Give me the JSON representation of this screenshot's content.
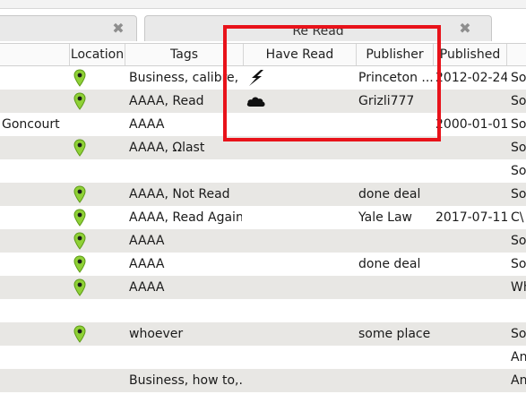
{
  "tabs": [
    {
      "label": "",
      "close_icon": "close-x-icon"
    },
    {
      "label": "Re Read",
      "close_icon": "close-x-icon"
    }
  ],
  "columns": [
    "Location",
    "Tags",
    "Have Read",
    "Publisher",
    "Published"
  ],
  "rows": [
    {
      "author": "",
      "location_pin": true,
      "tags": "Business, calibre, ...",
      "have_read_icon": "lightning-icon",
      "publisher": "Princeton ...",
      "published": "2012-02-24",
      "extra": "So"
    },
    {
      "author": "",
      "location_pin": true,
      "tags": "AAAA, Read",
      "have_read_icon": "cloud-icon",
      "publisher": "Grizli777",
      "published": "",
      "extra": "So"
    },
    {
      "author": "Goncourt",
      "location_pin": false,
      "tags": "AAAA",
      "have_read_icon": "",
      "publisher": "",
      "published": "2000-01-01",
      "extra": "So"
    },
    {
      "author": "",
      "location_pin": true,
      "tags": "AAAA, Ωlast",
      "have_read_icon": "",
      "publisher": "",
      "published": "",
      "extra": "So"
    },
    {
      "author": "",
      "location_pin": false,
      "tags": "",
      "have_read_icon": "",
      "publisher": "",
      "published": "",
      "extra": "So"
    },
    {
      "author": "",
      "location_pin": true,
      "tags": "AAAA, Not Read",
      "have_read_icon": "",
      "publisher": "done deal",
      "published": "",
      "extra": "So"
    },
    {
      "author": "",
      "location_pin": true,
      "tags": "AAAA, Read Again",
      "have_read_icon": "",
      "publisher": "Yale Law",
      "published": "2017-07-11",
      "extra": "C\\"
    },
    {
      "author": "",
      "location_pin": true,
      "tags": "AAAA",
      "have_read_icon": "",
      "publisher": "",
      "published": "",
      "extra": "So"
    },
    {
      "author": "",
      "location_pin": true,
      "tags": "AAAA",
      "have_read_icon": "",
      "publisher": "done deal",
      "published": "",
      "extra": "So"
    },
    {
      "author": "",
      "location_pin": true,
      "tags": "AAAA",
      "have_read_icon": "",
      "publisher": "",
      "published": "",
      "extra": "Wh"
    },
    {
      "author": "",
      "location_pin": false,
      "tags": "",
      "have_read_icon": "",
      "publisher": "",
      "published": "",
      "extra": ""
    },
    {
      "author": "",
      "location_pin": true,
      "tags": "whoever",
      "have_read_icon": "",
      "publisher": "some place",
      "published": "",
      "extra": "So"
    },
    {
      "author": "",
      "location_pin": false,
      "tags": "",
      "have_read_icon": "",
      "publisher": "",
      "published": "",
      "extra": "An"
    },
    {
      "author": "",
      "location_pin": false,
      "tags": "Business, how to,...",
      "have_read_icon": "",
      "publisher": "",
      "published": "",
      "extra": "An"
    }
  ],
  "colors": {
    "pin_green": "#8fd136",
    "row_alt": "#e8e7e4",
    "highlight": "#e8121a"
  }
}
